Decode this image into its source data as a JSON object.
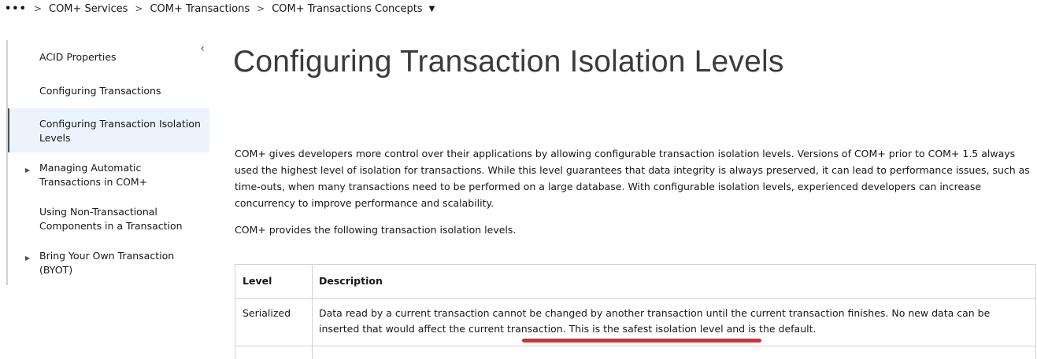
{
  "breadcrumb": {
    "more": "•••",
    "items": [
      "COM+ Services",
      "COM+ Transactions",
      "COM+ Transactions Concepts"
    ],
    "separator": ">",
    "dropdown_icon": "caret-down-icon"
  },
  "sidebar": {
    "collapse_icon": "chevron-left-icon",
    "items": [
      {
        "label": "ACID Properties",
        "expandable": false,
        "active": false
      },
      {
        "label": "Configuring Transactions",
        "expandable": false,
        "active": false
      },
      {
        "label": "Configuring Transaction Isolation Levels",
        "expandable": false,
        "active": true
      },
      {
        "label": "Managing Automatic Transactions in COM+",
        "expandable": true,
        "active": false
      },
      {
        "label": "Using Non-Transactional Components in a Transaction",
        "expandable": false,
        "active": false
      },
      {
        "label": "Bring Your Own Transaction (BYOT)",
        "expandable": true,
        "active": false
      }
    ],
    "expander_glyph": "▶"
  },
  "main": {
    "title": "Configuring Transaction Isolation Levels",
    "paragraph1": "COM+ gives developers more control over their applications by allowing configurable transaction isolation levels. Versions of COM+ prior to COM+ 1.5 always used the highest level of isolation for transactions. While this level guarantees that data integrity is always preserved, it can lead to performance issues, such as time-outs, when many transactions need to be performed on a large database. With configurable isolation levels, experienced developers can increase concurrency to improve performance and scalability.",
    "paragraph2": "COM+ provides the following transaction isolation levels.",
    "table": {
      "headers": [
        "Level",
        "Description"
      ],
      "rows": [
        {
          "level": "Serialized",
          "description_part1": "Data read by a current transaction cannot be changed by another transaction until the current transaction finishes. No new data can be inserted that would affect the current transaction. ",
          "description_part2": "This is the safest isolation level and is the default."
        }
      ]
    }
  },
  "colors": {
    "active_bg": "#ebf3fc",
    "border": "#d1d1d1",
    "annotation_underline": "#d32f2f"
  }
}
